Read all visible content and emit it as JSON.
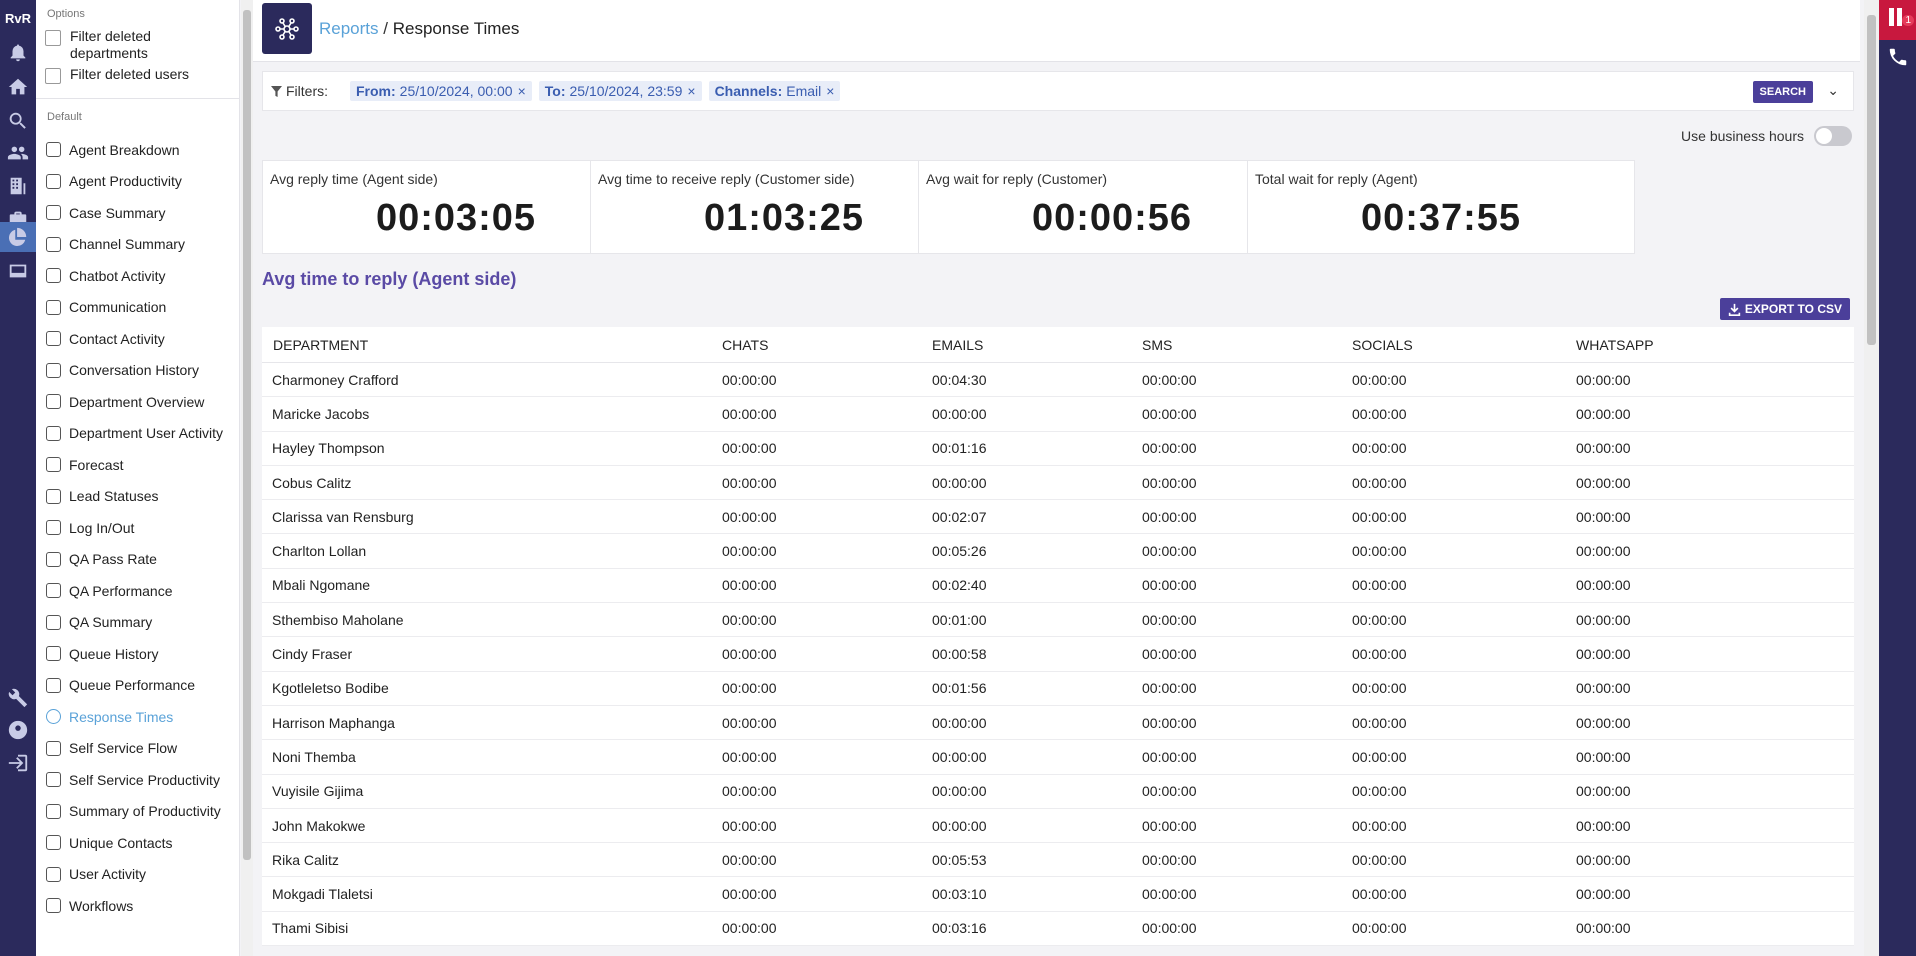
{
  "rail": {
    "logo": "RvR",
    "icons": [
      "bell-icon",
      "home-icon",
      "search-icon",
      "people-icon",
      "building-icon",
      "briefcase-icon",
      "reports-icon",
      "inbox-icon",
      "wrench-icon",
      "help-icon",
      "logout-icon"
    ]
  },
  "sidebar": {
    "options_title": "Options",
    "filter_deleted_departments": "Filter deleted departments",
    "filter_deleted_users": "Filter deleted users",
    "group_default": "Default",
    "items": [
      "Agent Breakdown",
      "Agent Productivity",
      "Case Summary",
      "Channel Summary",
      "Chatbot Activity",
      "Communication",
      "Contact Activity",
      "Conversation History",
      "Department Overview",
      "Department User Activity",
      "Forecast",
      "Lead Statuses",
      "Log In/Out",
      "QA Pass Rate",
      "QA Performance",
      "QA Summary",
      "Queue History",
      "Queue Performance",
      "Response Times",
      "Self Service Flow",
      "Self Service Productivity",
      "Summary of Productivity",
      "Unique Contacts",
      "User Activity",
      "Workflows"
    ],
    "active_item": "Response Times"
  },
  "header": {
    "crumb_link": "Reports",
    "crumb_sep": "/",
    "crumb_current": "Response Times"
  },
  "filters": {
    "label": "Filters:",
    "chips": [
      {
        "key": "From:",
        "value": "25/10/2024, 00:00"
      },
      {
        "key": "To:",
        "value": "25/10/2024, 23:59"
      },
      {
        "key": "Channels:",
        "value": "Email"
      }
    ],
    "search_label": "SEARCH"
  },
  "business_hours_label": "Use business hours",
  "stats": [
    {
      "label": "Avg reply time (Agent side)",
      "value": "00:03:05"
    },
    {
      "label": "Avg time to receive reply (Customer side)",
      "value": "01:03:25"
    },
    {
      "label": "Avg wait for reply (Customer)",
      "value": "00:00:56"
    },
    {
      "label": "Total wait for reply (Agent)",
      "value": "00:37:55"
    }
  ],
  "section_title": "Avg time to reply (Agent side)",
  "export_label": "EXPORT TO CSV",
  "table": {
    "columns": [
      "DEPARTMENT",
      "CHATS",
      "EMAILS",
      "SMS",
      "SOCIALS",
      "WHATSAPP"
    ],
    "rows": [
      [
        "Charmoney Crafford",
        "00:00:00",
        "00:04:30",
        "00:00:00",
        "00:00:00",
        "00:00:00"
      ],
      [
        "Maricke Jacobs",
        "00:00:00",
        "00:00:00",
        "00:00:00",
        "00:00:00",
        "00:00:00"
      ],
      [
        "Hayley Thompson",
        "00:00:00",
        "00:01:16",
        "00:00:00",
        "00:00:00",
        "00:00:00"
      ],
      [
        "Cobus Calitz",
        "00:00:00",
        "00:00:00",
        "00:00:00",
        "00:00:00",
        "00:00:00"
      ],
      [
        "Clarissa van Rensburg",
        "00:00:00",
        "00:02:07",
        "00:00:00",
        "00:00:00",
        "00:00:00"
      ],
      [
        "Charlton Lollan",
        "00:00:00",
        "00:05:26",
        "00:00:00",
        "00:00:00",
        "00:00:00"
      ],
      [
        "Mbali Ngomane",
        "00:00:00",
        "00:02:40",
        "00:00:00",
        "00:00:00",
        "00:00:00"
      ],
      [
        "Sthembiso Maholane",
        "00:00:00",
        "00:01:00",
        "00:00:00",
        "00:00:00",
        "00:00:00"
      ],
      [
        "Cindy Fraser",
        "00:00:00",
        "00:00:58",
        "00:00:00",
        "00:00:00",
        "00:00:00"
      ],
      [
        "Kgotleletso Bodibe",
        "00:00:00",
        "00:01:56",
        "00:00:00",
        "00:00:00",
        "00:00:00"
      ],
      [
        "Harrison Maphanga",
        "00:00:00",
        "00:00:00",
        "00:00:00",
        "00:00:00",
        "00:00:00"
      ],
      [
        "Noni Themba",
        "00:00:00",
        "00:00:00",
        "00:00:00",
        "00:00:00",
        "00:00:00"
      ],
      [
        "Vuyisile Gijima",
        "00:00:00",
        "00:00:00",
        "00:00:00",
        "00:00:00",
        "00:00:00"
      ],
      [
        "John Makokwe",
        "00:00:00",
        "00:00:00",
        "00:00:00",
        "00:00:00",
        "00:00:00"
      ],
      [
        "Rika Calitz",
        "00:00:00",
        "00:05:53",
        "00:00:00",
        "00:00:00",
        "00:00:00"
      ],
      [
        "Mokgadi Tlaletsi",
        "00:00:00",
        "00:03:10",
        "00:00:00",
        "00:00:00",
        "00:00:00"
      ],
      [
        "Thami Sibisi",
        "00:00:00",
        "00:03:16",
        "00:00:00",
        "00:00:00",
        "00:00:00"
      ]
    ]
  },
  "notification_badge": "1",
  "colors": {
    "rail": "#2b2a5c",
    "accent": "#4b3f9a",
    "link": "#5aa2d8",
    "alert": "#c8183e"
  }
}
